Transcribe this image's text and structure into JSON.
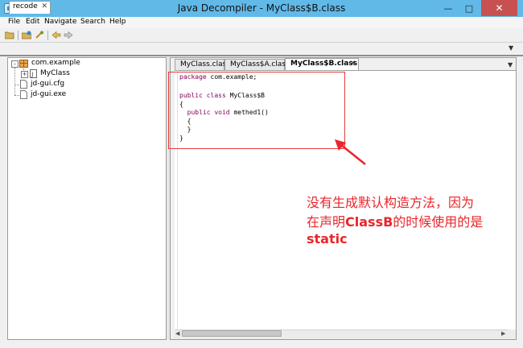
{
  "window": {
    "title": "Java Decompiler - MyClass$B.class"
  },
  "menubar": {
    "items": [
      "File",
      "Edit",
      "Navigate",
      "Search",
      "Help"
    ]
  },
  "outer_tab": {
    "label": "recode"
  },
  "tree": {
    "package": "com.example",
    "class_node": "MyClass",
    "files": [
      "jd-gui.cfg",
      "jd-gui.exe"
    ]
  },
  "editor_tabs": [
    "MyClass.class",
    "MyClass$A.class",
    "MyClass$B.class"
  ],
  "code_lines": [
    "package com.example;",
    "",
    "public class MyClass$B",
    "{",
    "  public void methed1()",
    "  {",
    "  }",
    "}"
  ],
  "annotation": {
    "line1": "没有生成默认构造方法，因为",
    "line2_prefix": "在声明",
    "line2_bold": "ClassB",
    "line2_suffix": "的时候使用的是",
    "line3": "static"
  },
  "colors": {
    "accent": "#61b9e8",
    "annotation": "#e8262b",
    "keyword": "#7f0055"
  }
}
